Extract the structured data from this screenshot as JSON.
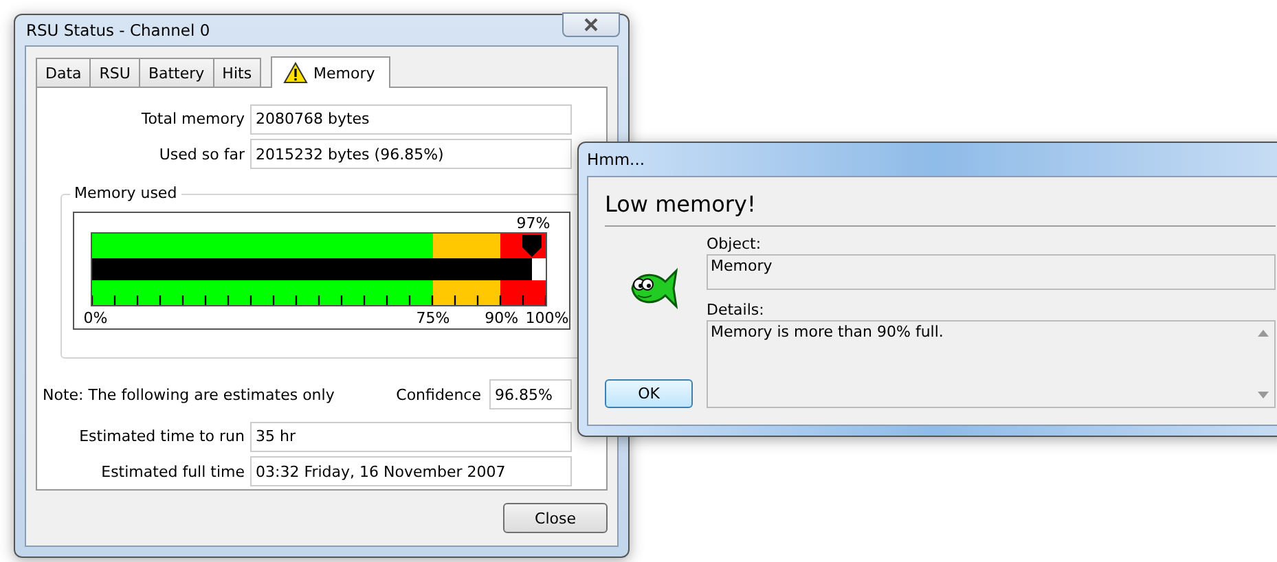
{
  "main_window": {
    "title": "RSU Status - Channel 0",
    "tabs": [
      {
        "label": "Data",
        "selected": false,
        "warning": false
      },
      {
        "label": "RSU",
        "selected": false,
        "warning": false
      },
      {
        "label": "Battery",
        "selected": false,
        "warning": false
      },
      {
        "label": "Hits",
        "selected": false,
        "warning": false
      },
      {
        "label": "Memory",
        "selected": true,
        "warning": true
      }
    ],
    "top_fields": [
      {
        "label": "Total memory",
        "value": "2080768 bytes"
      },
      {
        "label": "Used so far",
        "value": "2015232 bytes (96.85%)"
      }
    ],
    "memory_used": {
      "title": "Memory used",
      "reading": "97%",
      "level": 0.97,
      "zones": [
        {
          "color": "#00ff00"
        },
        {
          "color": "#ffc800"
        },
        {
          "color": "#ff0000"
        }
      ],
      "scale_labels": [
        "0%",
        "75%",
        "90%",
        "100%"
      ]
    },
    "note": "Note: The following are estimates only",
    "confidence": {
      "label": "Confidence",
      "value": "96.85%"
    },
    "estimate_fields": [
      {
        "label": "Estimated time to run",
        "value": "35 hr"
      },
      {
        "label": "Estimated full time",
        "value": "03:32 Friday, 16 November 2007"
      }
    ],
    "close_button": "Close"
  },
  "dialog": {
    "title": "Hmm...",
    "heading": "Low memory!",
    "object": {
      "label": "Object:",
      "value": "Memory"
    },
    "details": {
      "label": "Details:",
      "value": "Memory is more than 90% full."
    },
    "ok_button": "OK"
  }
}
